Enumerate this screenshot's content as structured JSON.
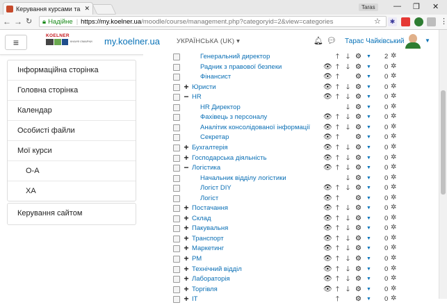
{
  "browser": {
    "tab_title": "Керування курсами та к",
    "tab_close": "✕",
    "profile_label": "Taras",
    "secure_label": "Надійне",
    "url_domain": "https://my.koelner.ua",
    "url_path": "/moodle/course/management.php?categoryid=2&view=categories"
  },
  "header": {
    "logo_brand": "KOELNER",
    "logo_sub": "КНАУФ ІЗМАРКИ",
    "site_name": "my.koelner.ua",
    "language": "УКРАЇНСЬКА (UK) ▾",
    "user_name": "Тарас Чайківський"
  },
  "sidebar": {
    "items": [
      {
        "label": "Інформаційна сторінка"
      },
      {
        "label": "Головна сторінка"
      },
      {
        "label": "Календар"
      },
      {
        "label": "Особисті файли"
      },
      {
        "label": "Мої курси"
      },
      {
        "label": "О-А"
      },
      {
        "label": "ХА"
      }
    ],
    "admin_label": "Керування сайтом"
  },
  "categories": [
    {
      "name": "Генеральний директор",
      "level": 2,
      "toggle": "",
      "eye": false,
      "up": true,
      "down": true,
      "count": "2"
    },
    {
      "name": "Радник з правової безпеки",
      "level": 2,
      "toggle": "",
      "eye": true,
      "up": true,
      "down": true,
      "count": "0"
    },
    {
      "name": "Фінансист",
      "level": 2,
      "toggle": "",
      "eye": true,
      "up": true,
      "down": false,
      "count": "0"
    },
    {
      "name": "Юристи",
      "level": 1,
      "toggle": "+",
      "eye": true,
      "up": true,
      "down": true,
      "count": "0"
    },
    {
      "name": "HR",
      "level": 1,
      "toggle": "−",
      "eye": true,
      "up": true,
      "down": true,
      "count": "0"
    },
    {
      "name": "HR Директор",
      "level": 2,
      "toggle": "",
      "eye": false,
      "up": false,
      "down": true,
      "count": "0"
    },
    {
      "name": "Фахівець з персоналу",
      "level": 2,
      "toggle": "",
      "eye": true,
      "up": true,
      "down": true,
      "count": "0"
    },
    {
      "name": "Аналітик консолідованої інформації",
      "level": 2,
      "toggle": "",
      "eye": true,
      "up": true,
      "down": true,
      "count": "0"
    },
    {
      "name": "Секретар",
      "level": 2,
      "toggle": "",
      "eye": true,
      "up": true,
      "down": false,
      "count": "0"
    },
    {
      "name": "Бухгалтерія",
      "level": 1,
      "toggle": "+",
      "eye": true,
      "up": true,
      "down": true,
      "count": "0"
    },
    {
      "name": "Господарська діяльність",
      "level": 1,
      "toggle": "+",
      "eye": true,
      "up": true,
      "down": true,
      "count": "0"
    },
    {
      "name": "Логістика",
      "level": 1,
      "toggle": "−",
      "eye": true,
      "up": true,
      "down": true,
      "count": "0"
    },
    {
      "name": "Начальник відділу логістики",
      "level": 2,
      "toggle": "",
      "eye": false,
      "up": false,
      "down": true,
      "count": "0"
    },
    {
      "name": "Логіст DIY",
      "level": 2,
      "toggle": "",
      "eye": true,
      "up": true,
      "down": true,
      "count": "0"
    },
    {
      "name": "Логіст",
      "level": 2,
      "toggle": "",
      "eye": true,
      "up": true,
      "down": false,
      "count": "0"
    },
    {
      "name": "Постачання",
      "level": 1,
      "toggle": "+",
      "eye": true,
      "up": true,
      "down": true,
      "count": "0"
    },
    {
      "name": "Склад",
      "level": 1,
      "toggle": "+",
      "eye": true,
      "up": true,
      "down": true,
      "count": "0"
    },
    {
      "name": "Пакувальня",
      "level": 1,
      "toggle": "+",
      "eye": true,
      "up": true,
      "down": true,
      "count": "0"
    },
    {
      "name": "Транспорт",
      "level": 1,
      "toggle": "+",
      "eye": true,
      "up": true,
      "down": true,
      "count": "0"
    },
    {
      "name": "Маркетинг",
      "level": 1,
      "toggle": "+",
      "eye": true,
      "up": true,
      "down": true,
      "count": "0"
    },
    {
      "name": "РМ",
      "level": 1,
      "toggle": "+",
      "eye": true,
      "up": true,
      "down": true,
      "count": "0"
    },
    {
      "name": "Технічний відділ",
      "level": 1,
      "toggle": "+",
      "eye": true,
      "up": true,
      "down": true,
      "count": "0"
    },
    {
      "name": "Лабораторія",
      "level": 1,
      "toggle": "+",
      "eye": true,
      "up": true,
      "down": true,
      "count": "0"
    },
    {
      "name": "Торгівля",
      "level": 1,
      "toggle": "+",
      "eye": true,
      "up": true,
      "down": true,
      "count": "0"
    },
    {
      "name": "IT",
      "level": 1,
      "toggle": "+",
      "eye": false,
      "up": true,
      "down": false,
      "count": "0"
    }
  ],
  "icons": {
    "eye": "eye-icon",
    "up": "arrow-up-icon",
    "down": "arrow-down-icon",
    "gear": "gear-icon",
    "spinner": "spinner-icon",
    "bell": "bell-icon",
    "chat": "chat-icon"
  },
  "colors": {
    "link": "#0a6fb5",
    "brand_red": "#c4161c",
    "secure_green": "#1a8a1a"
  }
}
